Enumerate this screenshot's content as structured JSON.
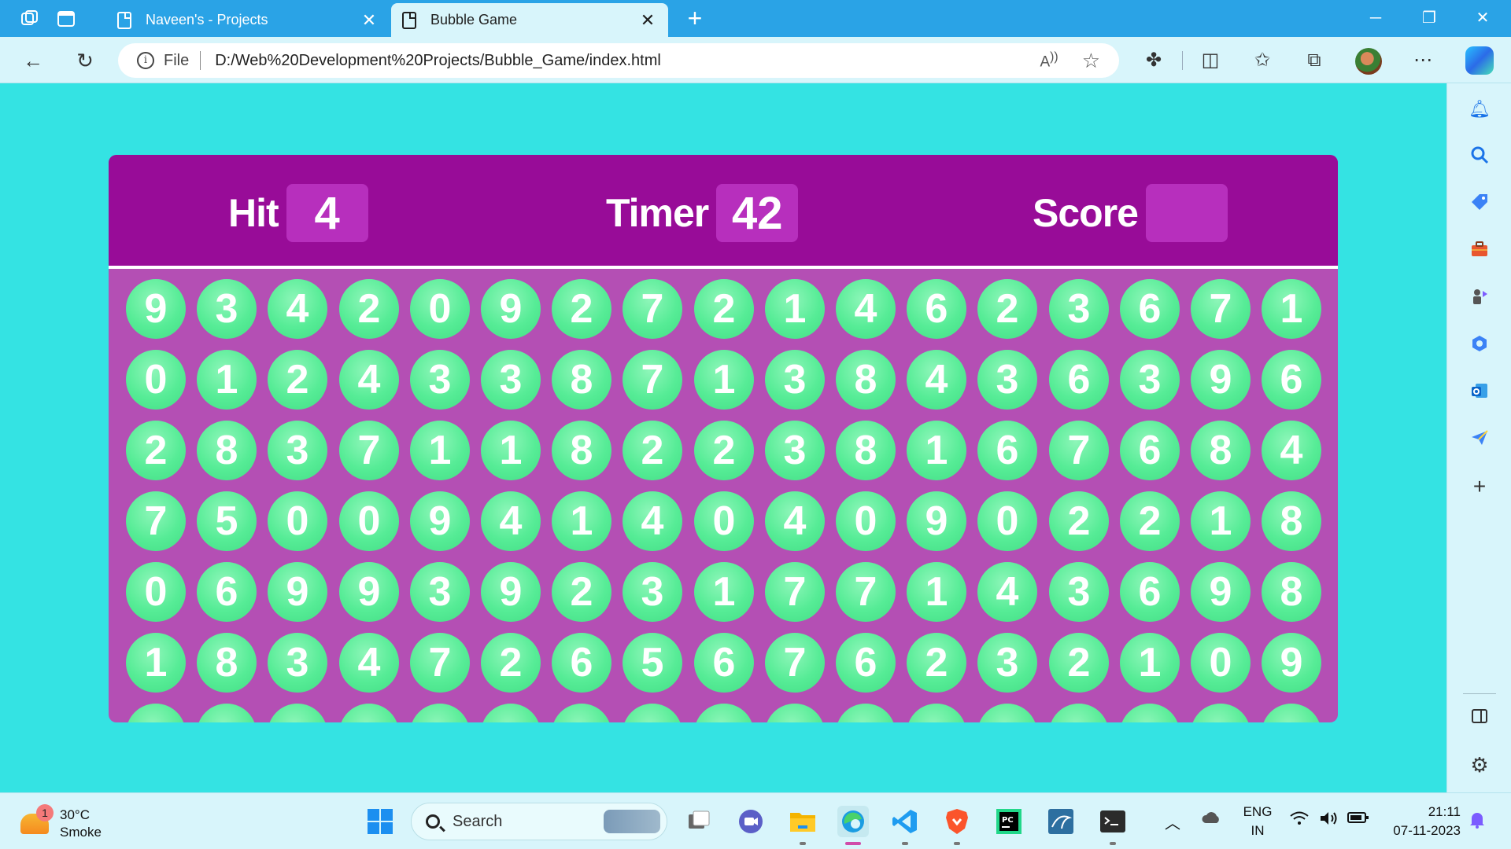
{
  "browser": {
    "tabs": [
      {
        "title": "Naveen's - Projects",
        "active": false
      },
      {
        "title": "Bubble Game",
        "active": true
      }
    ],
    "address": {
      "scheme_label": "File",
      "url": "D:/Web%20Development%20Projects/Bubble_Game/index.html"
    },
    "toolbar_icons": [
      "read-aloud-icon",
      "favorite-star-icon",
      "extensions-icon",
      "split-screen-icon",
      "favorites-icon",
      "collections-icon",
      "profile-avatar",
      "more-icon",
      "copilot-icon"
    ],
    "sidebar_icons": [
      "bell-icon",
      "search-icon",
      "shopping-tag-icon",
      "briefcase-icon",
      "games-icon",
      "copilot-app-icon",
      "outlook-icon",
      "send-icon",
      "add-icon",
      "sidebar-toggle-icon",
      "settings-icon"
    ]
  },
  "game": {
    "hit_label": "Hit",
    "hit_value": "4",
    "timer_label": "Timer",
    "timer_value": "42",
    "score_label": "Score",
    "score_value": "",
    "colors": {
      "panel": "#b44fb4",
      "header": "#980c98",
      "bubble": "#56ec96",
      "background": "#34e3e3"
    },
    "bubble_rows": [
      [
        9,
        3,
        4,
        2,
        0,
        9,
        2,
        7,
        2,
        1,
        4,
        6,
        2,
        3,
        6,
        7,
        1
      ],
      [
        0,
        1,
        2,
        4,
        3,
        3,
        8,
        7,
        1,
        3,
        8,
        4,
        3,
        6,
        3,
        9,
        6
      ],
      [
        2,
        8,
        3,
        7,
        1,
        1,
        8,
        2,
        2,
        3,
        8,
        1,
        6,
        7,
        6,
        8,
        4
      ],
      [
        7,
        5,
        0,
        0,
        9,
        4,
        1,
        4,
        0,
        4,
        0,
        9,
        0,
        2,
        2,
        1,
        8
      ],
      [
        0,
        6,
        9,
        9,
        3,
        9,
        2,
        3,
        1,
        7,
        7,
        1,
        4,
        3,
        6,
        9,
        8
      ],
      [
        1,
        8,
        3,
        4,
        7,
        2,
        6,
        5,
        6,
        7,
        6,
        2,
        3,
        2,
        1,
        0,
        9
      ],
      [
        "",
        "",
        "",
        "",
        "",
        "",
        "",
        "",
        "",
        "",
        "",
        "",
        "",
        "",
        "",
        "",
        ""
      ]
    ]
  },
  "taskbar": {
    "weather": {
      "badge": "1",
      "temp": "30°C",
      "condition": "Smoke"
    },
    "search_placeholder": "Search",
    "apps": [
      "windows-start-icon",
      "task-view-icon",
      "meet-icon",
      "file-explorer-icon",
      "edge-icon",
      "vscode-icon",
      "brave-icon",
      "pycharm-icon",
      "mysql-icon",
      "terminal-icon"
    ],
    "language": {
      "line1": "ENG",
      "line2": "IN"
    },
    "time": "21:11",
    "date": "07-11-2023"
  }
}
